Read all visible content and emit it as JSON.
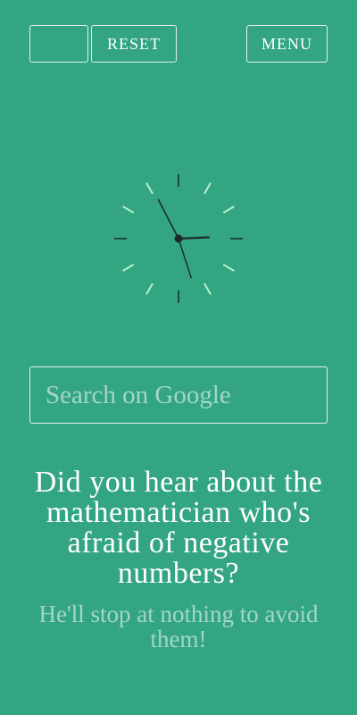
{
  "toolbar": {
    "blank_label": "",
    "reset_label": "RESET",
    "menu_label": "MENU"
  },
  "clock": {
    "time": {
      "hour": 2,
      "minute": 55,
      "second": 27
    },
    "colors": {
      "marker_light": "#b5f2c8",
      "marker_dark": "#1a4a3a",
      "hands": "#1d2b27"
    }
  },
  "search": {
    "placeholder": "Search on Google",
    "value": ""
  },
  "joke": {
    "setup": "Did you hear about the mathematician who's afraid of negative numbers?",
    "punchline": "He'll stop at nothing to avoid them!"
  },
  "theme": {
    "background": "#33a582",
    "text": "#ffffff"
  }
}
